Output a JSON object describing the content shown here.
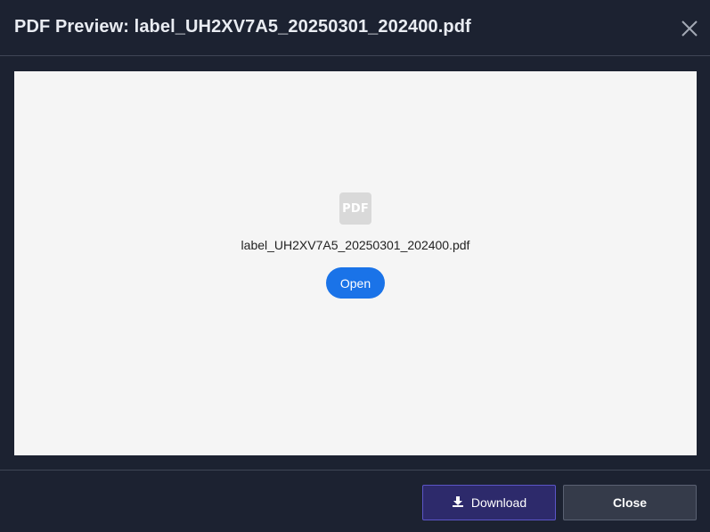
{
  "dialog": {
    "title": "PDF Preview: label_UH2XV7A5_20250301_202400.pdf",
    "close_icon": "close-icon"
  },
  "viewer": {
    "file_icon": "pdf-file-icon",
    "file_icon_label": "PDF",
    "file_name": "label_UH2XV7A5_20250301_202400.pdf",
    "open_label": "Open"
  },
  "footer": {
    "download_label": "Download",
    "download_icon": "download-icon",
    "close_label": "Close"
  },
  "colors": {
    "background": "#1c2231",
    "viewer_background": "#f5f5f5",
    "open_button": "#1a73e8",
    "download_button": "#2d2a6b",
    "close_button": "#353b4a"
  }
}
